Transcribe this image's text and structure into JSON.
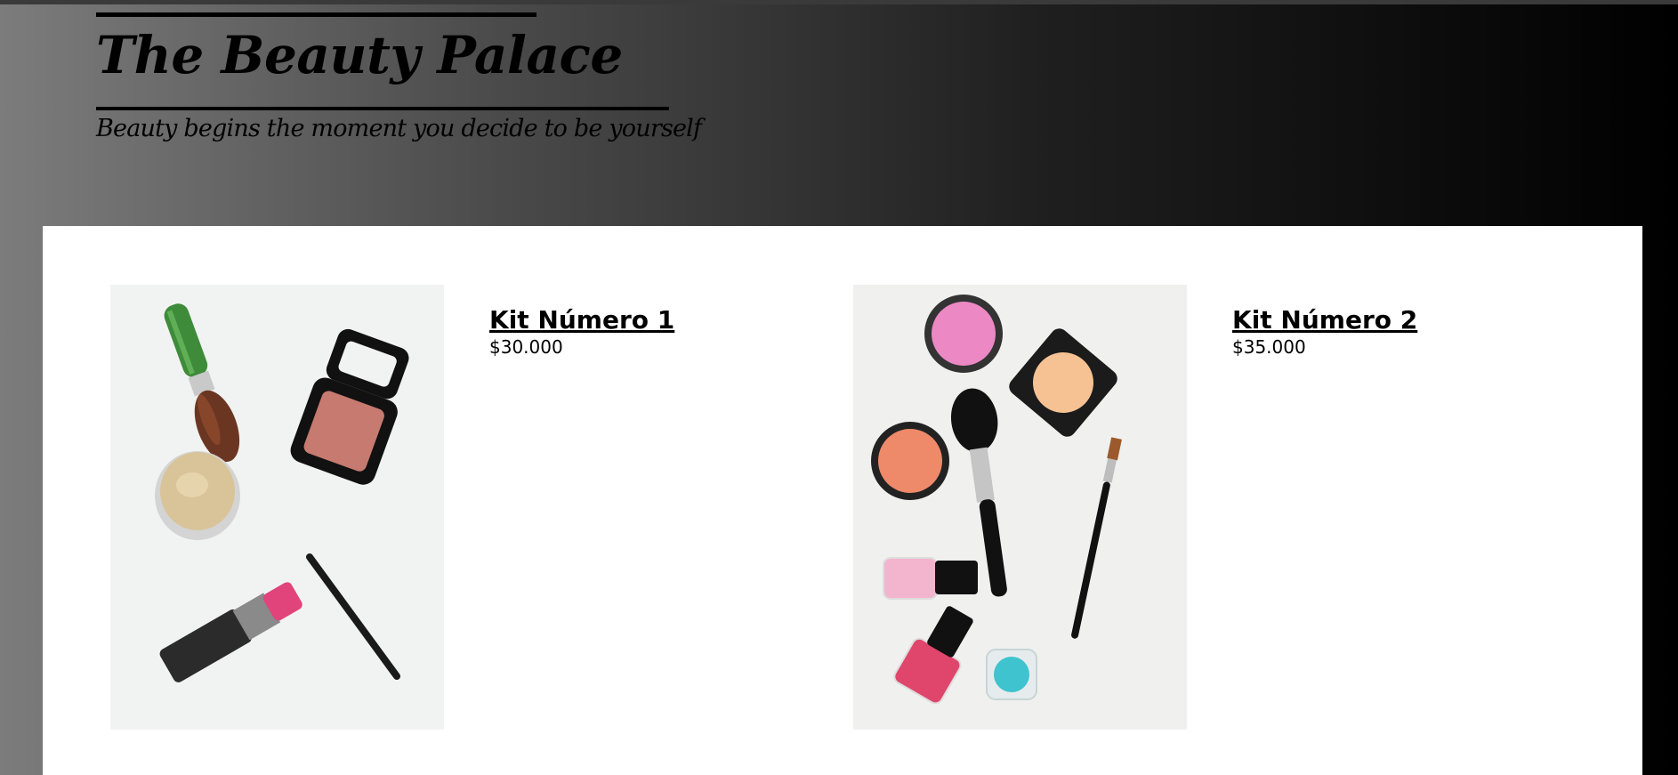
{
  "site": {
    "title": "The Beauty Palace",
    "tagline": "Beauty begins the moment you decide to be yourself"
  },
  "products": [
    {
      "name": "Kit Número 1",
      "price": "$30.000"
    },
    {
      "name": "Kit Número 2",
      "price": "$35.000"
    }
  ],
  "colors": {
    "header_gradient": [
      "#7c7c7c",
      "#000000"
    ],
    "content_bg": "#ffffff",
    "text": "#000000"
  }
}
